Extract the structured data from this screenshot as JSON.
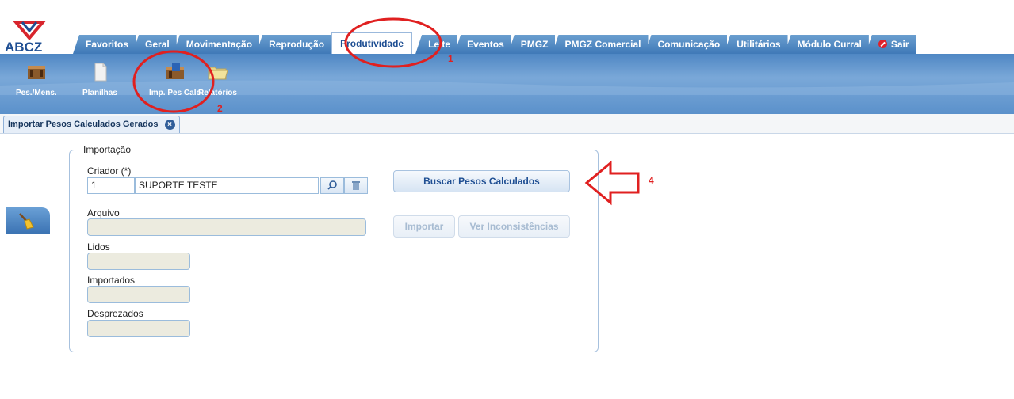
{
  "app": {
    "logo_text": "ABCZ"
  },
  "tabs": [
    {
      "label": "Favoritos"
    },
    {
      "label": "Geral"
    },
    {
      "label": "Movimentação"
    },
    {
      "label": "Reprodução"
    },
    {
      "label": "Produtividade",
      "active": true
    },
    {
      "label": "Leite"
    },
    {
      "label": "Eventos"
    },
    {
      "label": "PMGZ"
    },
    {
      "label": "PMGZ Comercial"
    },
    {
      "label": "Comunicação"
    },
    {
      "label": "Utilitários"
    },
    {
      "label": "Módulo Curral"
    },
    {
      "label": "Sair",
      "icon": "stop-icon"
    }
  ],
  "toolbar": {
    "items": [
      {
        "label": "Pes./Mens.",
        "icon": "scale-icon"
      },
      {
        "label": "Planilhas",
        "icon": "document-icon"
      },
      {
        "label": "Imp. Pes Calc",
        "icon": "import-scale-icon"
      },
      {
        "label": "Relatórios",
        "icon": "folder-icon"
      }
    ]
  },
  "page_tab": {
    "label": "Importar Pesos Calculados Gerados",
    "close_icon": "close-icon"
  },
  "form": {
    "legend": "Importação",
    "criador_label": "Criador (*)",
    "criador_code": "1",
    "criador_name": "SUPORTE TESTE",
    "arquivo_label": "Arquivo",
    "arquivo_value": "",
    "lidos_label": "Lidos",
    "lidos_value": "",
    "importados_label": "Importados",
    "importados_value": "",
    "desprezados_label": "Desprezados",
    "desprezados_value": "",
    "buscar_button": "Buscar Pesos Calculados",
    "importar_button": "Importar",
    "ver_inconsistencias_button": "Ver Inconsistências"
  },
  "annotations": {
    "step1": "1",
    "step2": "2",
    "step4": "4"
  },
  "colors": {
    "accent": "#1f4f93",
    "annotation": "#e02020",
    "toolbar": "#5b91cb"
  }
}
